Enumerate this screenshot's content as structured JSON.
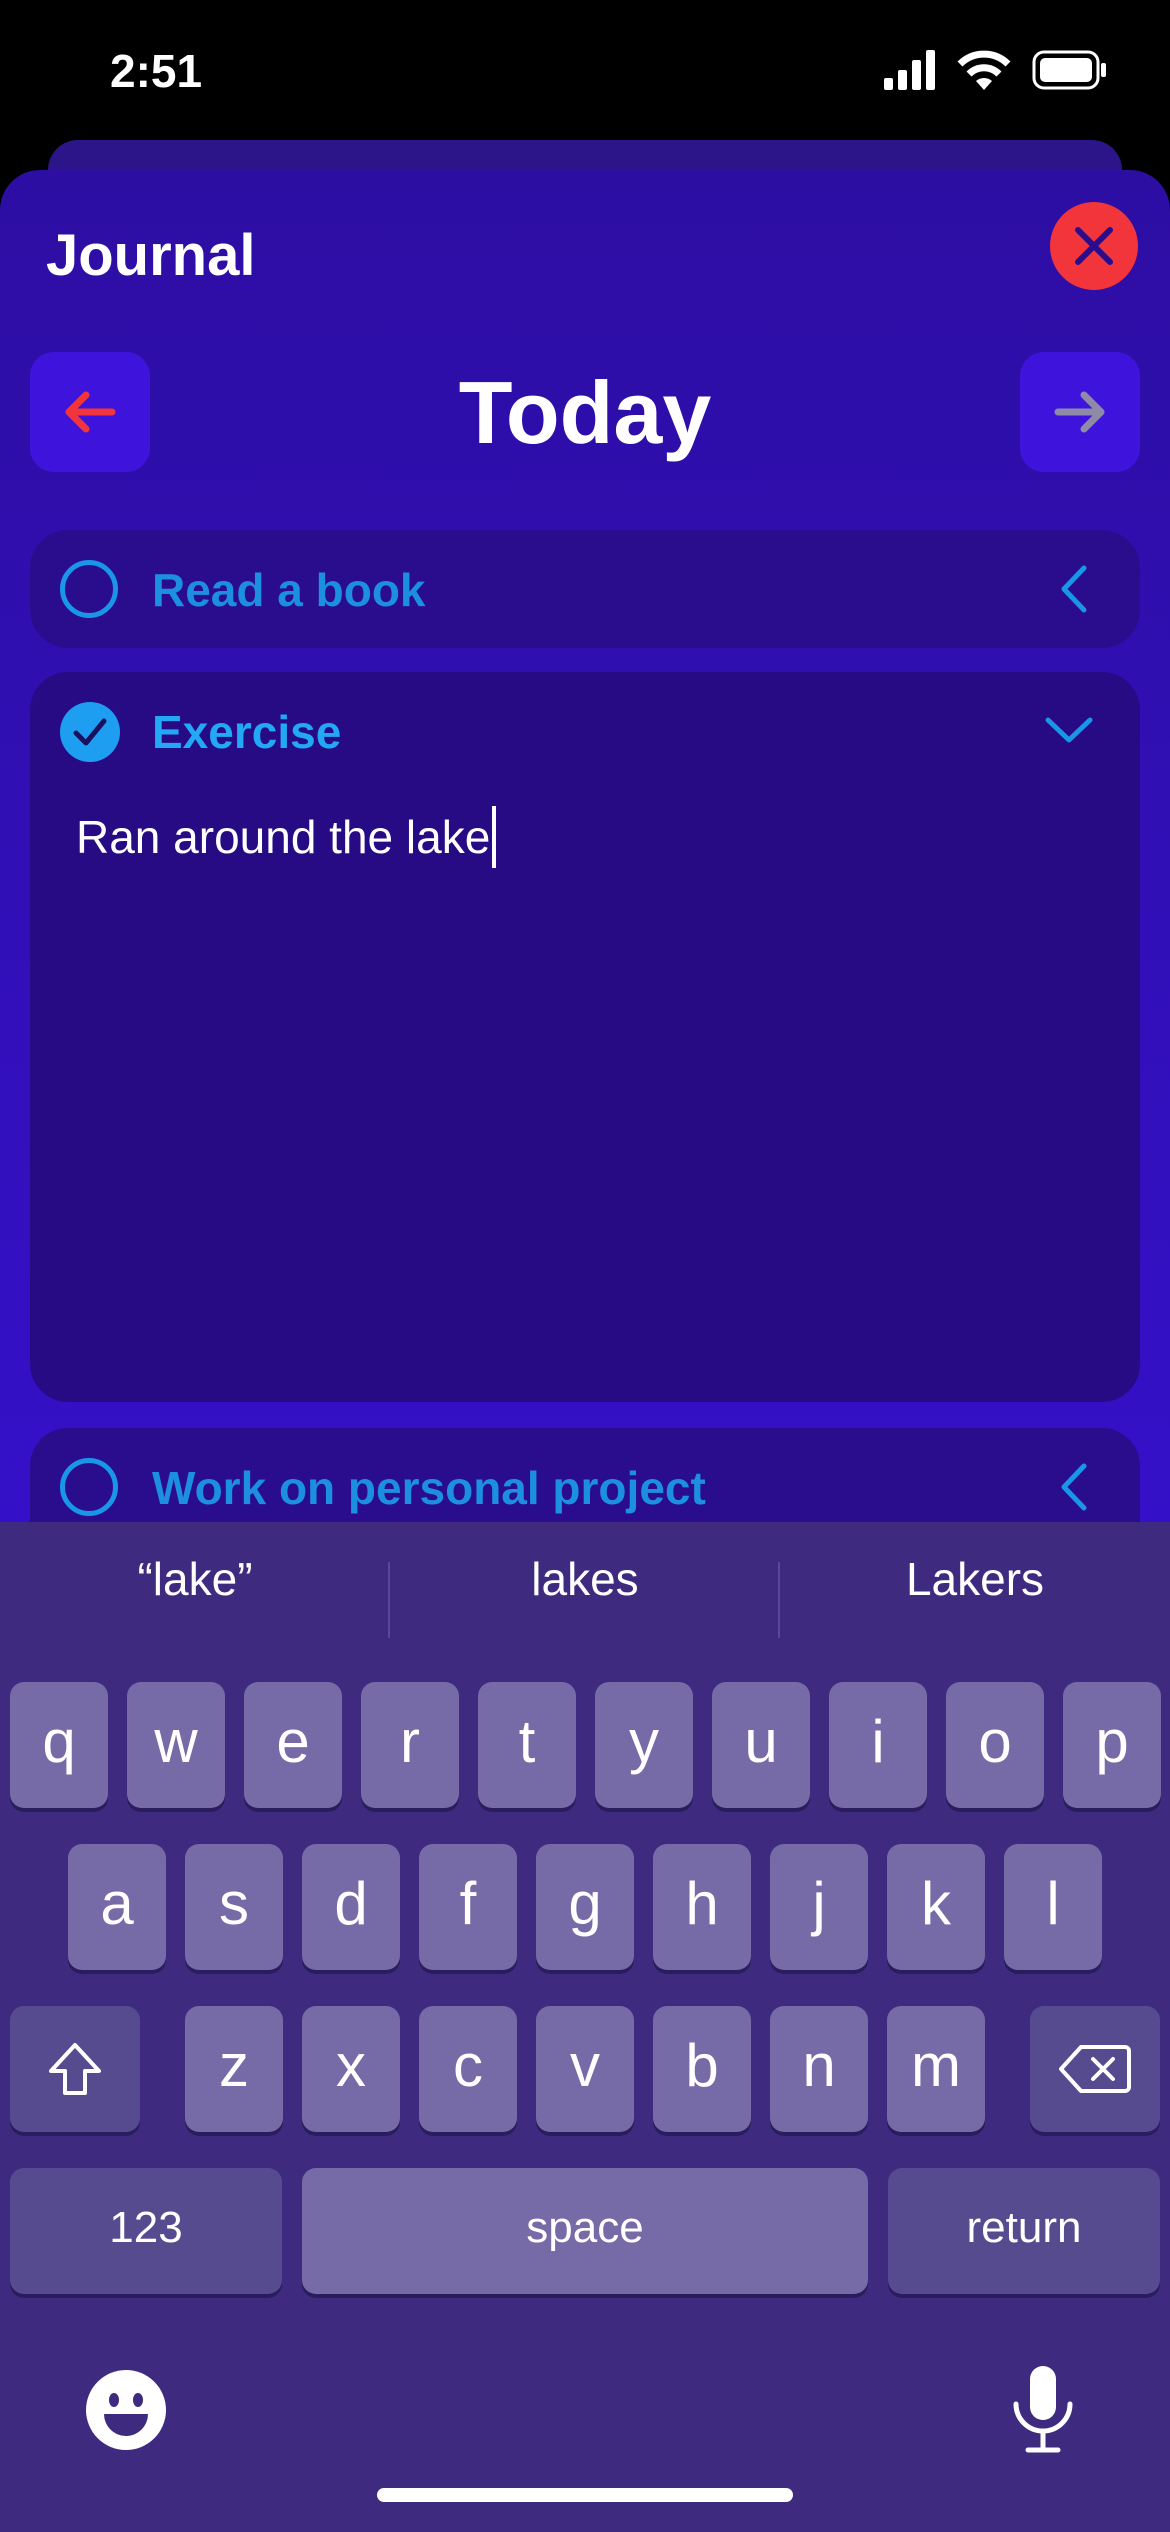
{
  "status_bar": {
    "time": "2:51",
    "icons": [
      "cellular-signal-icon",
      "wifi-icon",
      "battery-icon"
    ]
  },
  "sheet": {
    "title": "Journal",
    "close_icon": "close-icon"
  },
  "day_nav": {
    "title": "Today",
    "prev_icon": "arrow-left-icon",
    "next_icon": "arrow-right-icon"
  },
  "habits": [
    {
      "label": "Read a book",
      "completed": false,
      "expanded": false
    },
    {
      "label": "Exercise",
      "completed": true,
      "expanded": true,
      "note": "Ran around the lake"
    },
    {
      "label": "Work on personal project",
      "completed": false,
      "expanded": false
    }
  ],
  "keyboard": {
    "suggestions": [
      "“lake”",
      "lakes",
      "Lakers"
    ],
    "rows": [
      [
        "q",
        "w",
        "e",
        "r",
        "t",
        "y",
        "u",
        "i",
        "o",
        "p"
      ],
      [
        "a",
        "s",
        "d",
        "f",
        "g",
        "h",
        "j",
        "k",
        "l"
      ],
      [
        "z",
        "x",
        "c",
        "v",
        "b",
        "n",
        "m"
      ]
    ],
    "numbers_label": "123",
    "space_label": "space",
    "return_label": "return"
  },
  "colors": {
    "sheet_bg": "#3410c8",
    "accent_blue": "#1e9ef0",
    "close_red": "#f2353b",
    "keyboard_bg": "#3e2b7f"
  }
}
